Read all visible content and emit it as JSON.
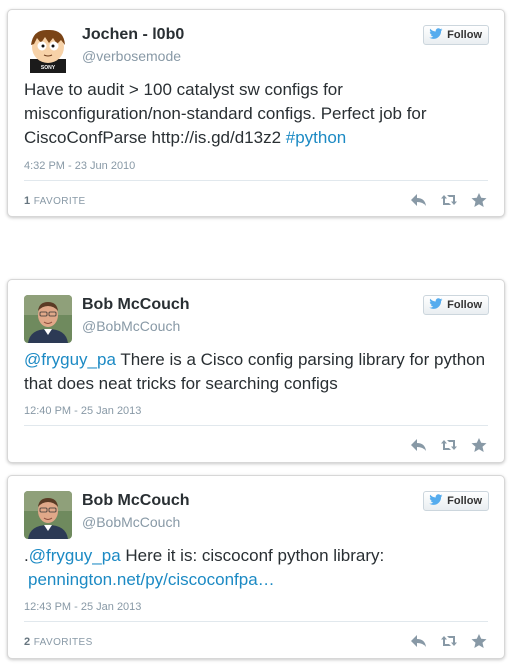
{
  "tweets": [
    {
      "name": "Jochen - l0b0",
      "handle": "@verbosemode",
      "follow_label": "Follow",
      "text_plain": "Have to audit > 100 catalyst sw configs for misconfiguration/non-standard configs. Perfect job for CiscoConfParse http://is.gd/d13z2 ",
      "text_link": "#python",
      "date": "4:32 PM - 23 Jun 2010",
      "fav_count": "1",
      "fav_label": "FAVORITE",
      "avatar_text": "SONY"
    },
    {
      "name": "Bob McCouch",
      "handle": "@BobMcCouch",
      "follow_label": "Follow",
      "text_link": "@fryguy_pa",
      "text_plain": " There is a Cisco config parsing library for python that does neat tricks for searching configs",
      "date": "12:40 PM - 25 Jan 2013"
    },
    {
      "name": "Bob McCouch",
      "handle": "@BobMcCouch",
      "follow_label": "Follow",
      "text_prefix": ".",
      "text_link": "@fryguy_pa",
      "text_plain": " Here it is: ciscoconf python library:",
      "text_link2": "pennington.net/py/ciscoconfpa…",
      "date": "12:43 PM - 25 Jan 2013",
      "fav_count": "2",
      "fav_label": "FAVORITES"
    }
  ],
  "colors": {
    "link": "#1c8ac4",
    "muted": "#8899a6",
    "twitter_bird": "#55acee"
  },
  "icons": [
    "twitter-bird-icon",
    "reply-icon",
    "retweet-icon",
    "favorite-star-icon"
  ]
}
